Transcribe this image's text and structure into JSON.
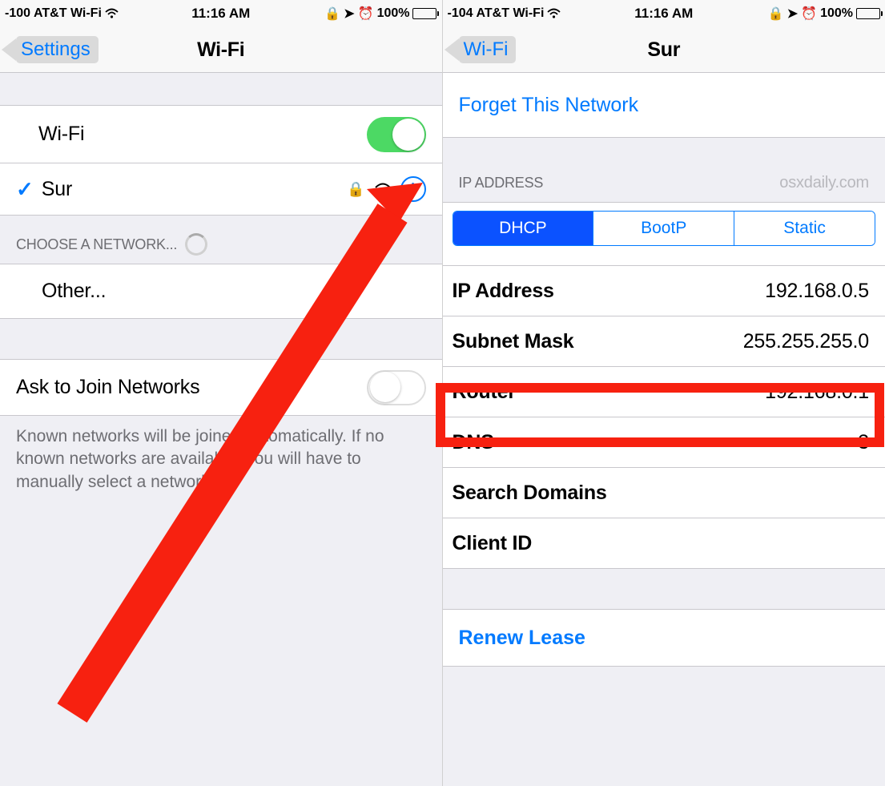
{
  "left": {
    "statusbar": {
      "signal": "-100",
      "carrier": "AT&T Wi-Fi",
      "time": "11:16 AM",
      "battery": "100%"
    },
    "nav": {
      "back": "Settings",
      "title": "Wi-Fi"
    },
    "wifi_toggle_label": "Wi-Fi",
    "network": {
      "name": "Sur"
    },
    "choose_header": "CHOOSE A NETWORK...",
    "other": "Other...",
    "ask_join_label": "Ask to Join Networks",
    "footer": "Known networks will be joined automatically. If no known networks are available, you will have to manually select a network."
  },
  "right": {
    "statusbar": {
      "signal": "-104",
      "carrier": "AT&T Wi-Fi",
      "time": "11:16 AM",
      "battery": "100%"
    },
    "nav": {
      "back": "Wi-Fi",
      "title": "Sur"
    },
    "forget": "Forget This Network",
    "ip_header": "IP ADDRESS",
    "watermark": "osxdaily.com",
    "tabs": {
      "dhcp": "DHCP",
      "bootp": "BootP",
      "static": "Static"
    },
    "rows": {
      "ip_label": "IP Address",
      "ip_value": "192.168.0.5",
      "subnet_label": "Subnet Mask",
      "subnet_value": "255.255.255.0",
      "router_label": "Router",
      "router_value": "192.168.0.1",
      "dns_label": "DNS",
      "dns_value": "3",
      "search_label": "Search Domains",
      "search_value": "",
      "client_label": "Client ID",
      "client_value": ""
    },
    "renew": "Renew Lease"
  }
}
